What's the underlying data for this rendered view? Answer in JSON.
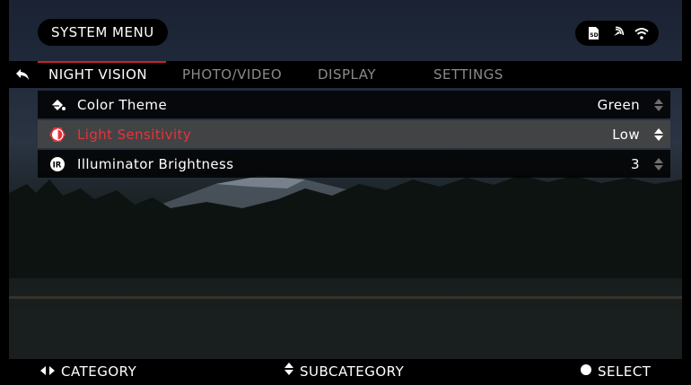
{
  "header": {
    "title": "SYSTEM MENU",
    "status_icons": [
      "sd-card-icon",
      "gps-icon",
      "wifi-icon"
    ]
  },
  "tabs": [
    {
      "label": "NIGHT VISION",
      "active": true
    },
    {
      "label": "PHOTO/VIDEO",
      "active": false
    },
    {
      "label": "DISPLAY",
      "active": false
    },
    {
      "label": "SETTINGS",
      "active": false
    }
  ],
  "menu": [
    {
      "icon": "paint-bucket-icon",
      "label": "Color Theme",
      "value": "Green",
      "selected": false
    },
    {
      "icon": "light-sensitivity-icon",
      "label": "Light Sensitivity",
      "value": "Low",
      "selected": true
    },
    {
      "icon": "ir-icon",
      "label": "Illuminator Brightness",
      "value": "3",
      "selected": false
    }
  ],
  "footer": {
    "category": "CATEGORY",
    "subcategory": "SUBCATEGORY",
    "select": "SELECT"
  },
  "colors": {
    "accent": "#c8232c",
    "selected_text": "#e8333a"
  }
}
